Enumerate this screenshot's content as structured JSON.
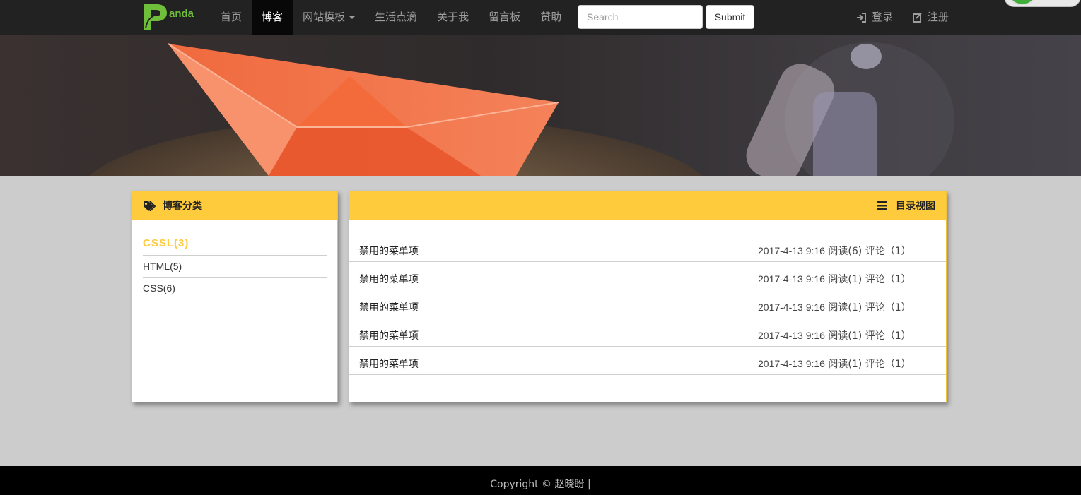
{
  "brand": {
    "text": "anda",
    "logo_letter": "P",
    "accent": "#6fbf3a"
  },
  "nav": {
    "items": [
      {
        "label": "首页",
        "active": false
      },
      {
        "label": "博客",
        "active": true
      },
      {
        "label": "网站模板",
        "active": false,
        "dropdown": true
      },
      {
        "label": "生活点滴",
        "active": false
      },
      {
        "label": "关于我",
        "active": false
      },
      {
        "label": "留言板",
        "active": false
      },
      {
        "label": "赞助",
        "active": false
      }
    ],
    "search_placeholder": "Search",
    "submit_label": "Submit",
    "login_label": "登录",
    "register_label": "注册",
    "login_icon": "log-in-icon",
    "register_icon": "edit-icon"
  },
  "banner": {
    "subject": "paper-boat-banner"
  },
  "categories_panel": {
    "title": "博客分类",
    "icon": "tags-icon",
    "items": [
      "CSSL(3)",
      "HTML(5)",
      "CSS(6)"
    ]
  },
  "list_panel": {
    "title": "目录视图",
    "icon": "list-icon",
    "rows": [
      {
        "title": "禁用的菜单项",
        "date": "2017-4-13 9:16",
        "reads": "阅读(6)",
        "comments": "评论（1）"
      },
      {
        "title": "禁用的菜单项",
        "date": "2017-4-13 9:16",
        "reads": "阅读(1)",
        "comments": "评论（1）"
      },
      {
        "title": "禁用的菜单项",
        "date": "2017-4-13 9:16",
        "reads": "阅读(1)",
        "comments": "评论（1）"
      },
      {
        "title": "禁用的菜单项",
        "date": "2017-4-13 9:16",
        "reads": "阅读(1)",
        "comments": "评论（1）"
      },
      {
        "title": "禁用的菜单项",
        "date": "2017-4-13 9:16",
        "reads": "阅读(1)",
        "comments": "评论（1）"
      }
    ]
  },
  "footer": {
    "text": "Copyright © 赵晓盼 |"
  },
  "colors": {
    "accent": "#fecb3c",
    "navbar": "#222222",
    "page_bg": "#cccccc"
  }
}
